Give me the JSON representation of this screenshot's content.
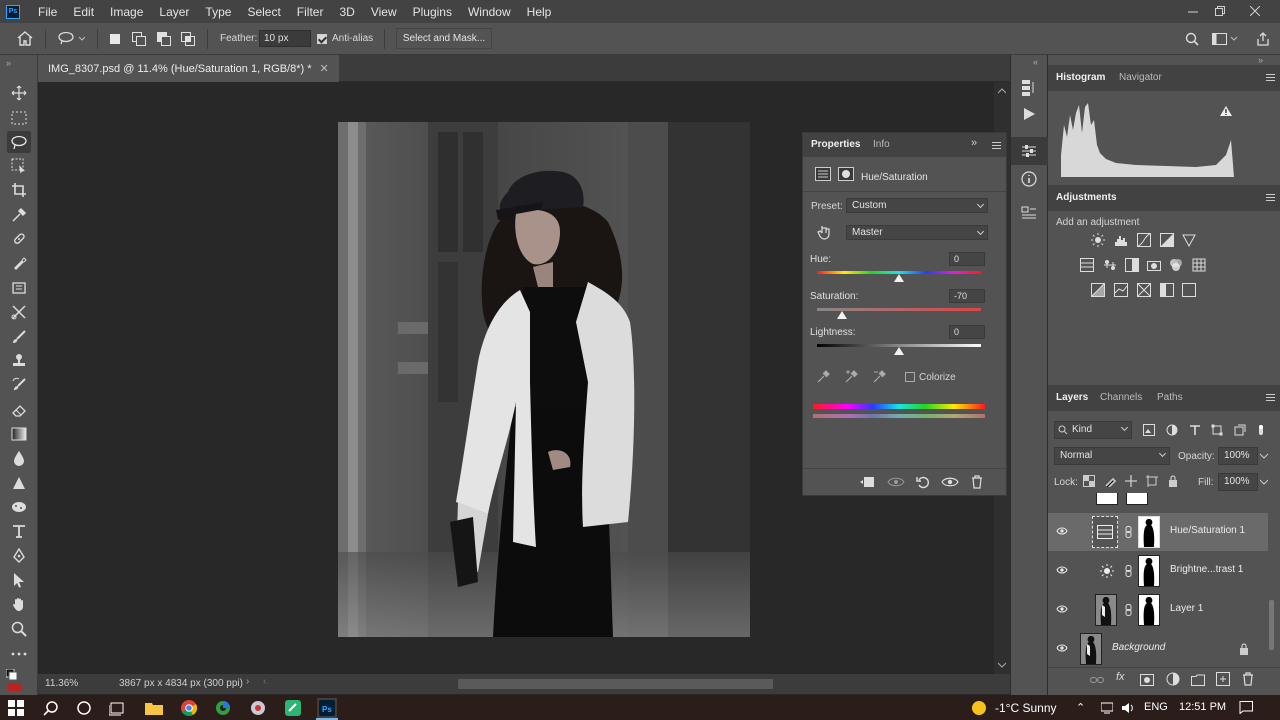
{
  "app": {
    "logo_text": "Ps",
    "menu": [
      "File",
      "Edit",
      "Image",
      "Layer",
      "Type",
      "Select",
      "Filter",
      "3D",
      "View",
      "Plugins",
      "Window",
      "Help"
    ]
  },
  "options": {
    "feather_label": "Feather:",
    "feather_value": "10 px",
    "antialias_label": "Anti-alias",
    "select_mask_label": "Select and Mask..."
  },
  "document": {
    "tab_title": "IMG_8307.psd @ 11.4% (Hue/Saturation 1, RGB/8*) *",
    "zoom": "11.36%",
    "info": "3867 px x 4834 px (300 ppi)"
  },
  "properties": {
    "tab_properties": "Properties",
    "tab_info": "Info",
    "adjustment_title": "Hue/Saturation",
    "preset_label": "Preset:",
    "preset_value": "Custom",
    "channel_value": "Master",
    "hue_label": "Hue:",
    "hue_value": "0",
    "saturation_label": "Saturation:",
    "saturation_value": "-70",
    "lightness_label": "Lightness:",
    "lightness_value": "0",
    "colorize_label": "Colorize",
    "hue_slider": 0,
    "saturation_slider": -70,
    "lightness_slider": 0
  },
  "panels": {
    "histogram_tab": "Histogram",
    "navigator_tab": "Navigator",
    "adjustments_title": "Adjustments",
    "adjustments_hint": "Add an adjustment",
    "layers_tab": "Layers",
    "channels_tab": "Channels",
    "paths_tab": "Paths",
    "filter_kind": "Kind",
    "blend_mode": "Normal",
    "opacity_label": "Opacity:",
    "opacity_value": "100%",
    "lock_label": "Lock:",
    "fill_label": "Fill:",
    "fill_value": "100%"
  },
  "layers": [
    {
      "name": "Hue/Saturation 1",
      "selected": true
    },
    {
      "name": "Brightne...trast 1",
      "selected": false
    },
    {
      "name": "Layer 1",
      "selected": false
    },
    {
      "name": "Background",
      "selected": false
    }
  ],
  "taskbar": {
    "weather": "-1°C  Sunny",
    "language": "ENG",
    "time": "12:51 PM"
  }
}
